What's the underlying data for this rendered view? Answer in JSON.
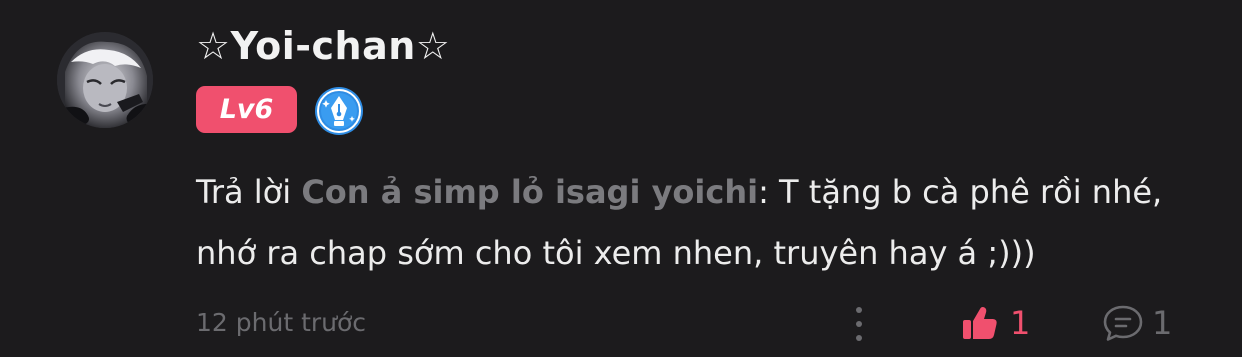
{
  "comment": {
    "username": "☆Yoi-chan☆",
    "level_badge": "Lv6",
    "reply_prefix": "Trả lời ",
    "reply_to": "Con ả simp lỏ isagi yoichi",
    "body": ": T tặng b cà phê rồi nhé, nhớ ra chap sớm cho tôi xem nhen, truyên hay á ;)))",
    "timestamp": "12 phút trước",
    "likes": "1",
    "replies": "1"
  },
  "icons": {
    "avatar": "anime-avatar",
    "badge": "fountain-pen-icon",
    "more": "more-vertical-icon",
    "like": "thumbs-up-icon",
    "reply": "comment-icon"
  },
  "colors": {
    "background": "#1c1b1d",
    "accent": "#f0506e",
    "mention": "#7b7b7f",
    "muted": "#6b6b6f",
    "badge_blue": "#2f8de4"
  }
}
